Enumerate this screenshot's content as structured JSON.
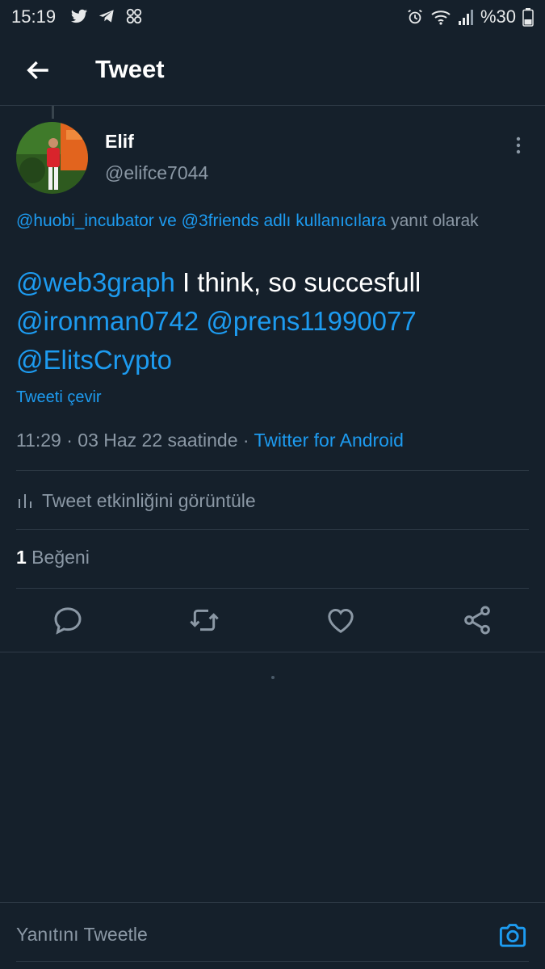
{
  "status_bar": {
    "time": "15:19",
    "left_icons": [
      "twitter-icon",
      "telegram-icon",
      "app-icon"
    ],
    "right_icons": [
      "alarm-icon",
      "wifi-icon",
      "signal-icon",
      "battery-icon"
    ],
    "battery_text": "%30"
  },
  "header": {
    "title": "Tweet"
  },
  "tweet": {
    "author_name": "Elif",
    "author_handle": "@elifce7044",
    "reply_to": {
      "mention_1": "@huobi_incubator",
      "connector": " ve ",
      "mention_2": "@3friends adlı kullanıcılara",
      "suffix": " yanıt olarak"
    },
    "text": {
      "mention_1": "@web3graph",
      "plain": " I think, so succesfull ",
      "mention_2": "@ironman0742",
      "mention_3": "@prens11990077",
      "mention_4": "@ElitsCrypto"
    },
    "translate_label": "Tweeti çevir",
    "meta": {
      "time_date": "11:29 · 03 Haz 22 saatinde · ",
      "source": "Twitter for Android"
    },
    "activity_label": "Tweet etkinliğini görüntüle",
    "likes": {
      "count": "1",
      "label": " Beğeni"
    }
  },
  "actions": [
    "reply-icon",
    "retweet-icon",
    "like-icon",
    "share-icon"
  ],
  "composer": {
    "placeholder": "Yanıtını Tweetle"
  },
  "colors": {
    "background": "#15202b",
    "accent": "#1d9bf0",
    "muted": "#8b98a5",
    "divider": "#2f3b47"
  }
}
